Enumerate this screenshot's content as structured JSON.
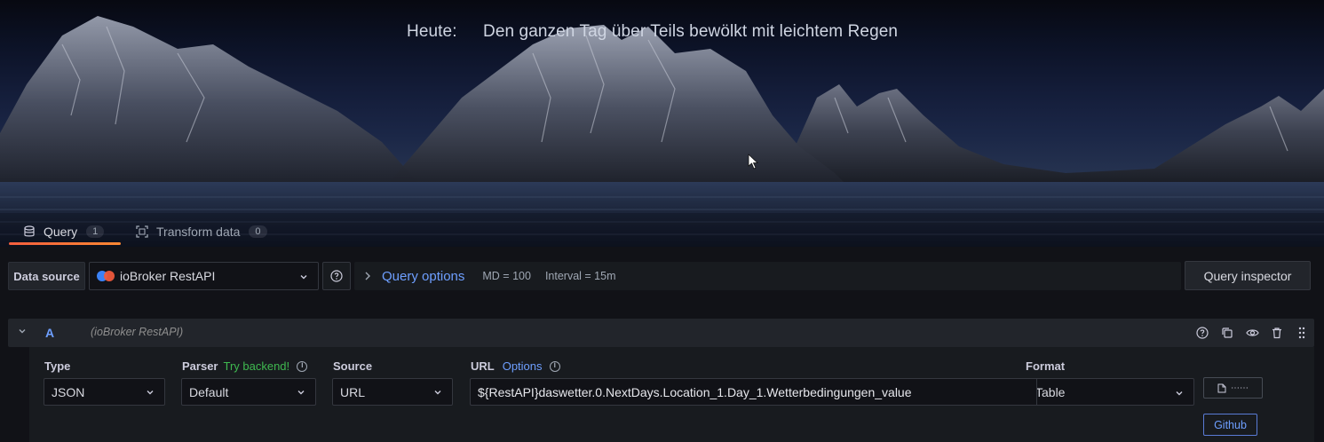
{
  "hero": {
    "label": "Heute:",
    "value": "Den ganzen Tag über Teils bewölkt mit leichtem Regen"
  },
  "tabs": [
    {
      "label": "Query",
      "count": "1",
      "icon": "database-icon",
      "active": true
    },
    {
      "label": "Transform data",
      "count": "0",
      "icon": "transform-icon",
      "active": false
    }
  ],
  "datasource": {
    "label": "Data source",
    "selected": "ioBroker RestAPI"
  },
  "query_options": {
    "title": "Query options",
    "md": "MD = 100",
    "interval": "Interval = 15m"
  },
  "query_inspector": "Query inspector",
  "query_row": {
    "name": "A",
    "datasource": "(ioBroker RestAPI)",
    "actions": [
      "help-icon",
      "copy-icon",
      "eye-icon",
      "trash-icon",
      "drag-handle-icon"
    ]
  },
  "fields": {
    "type": {
      "label": "Type",
      "value": "JSON"
    },
    "parser": {
      "label": "Parser",
      "hint": "Try backend!",
      "value": "Default"
    },
    "source": {
      "label": "Source",
      "value": "URL"
    },
    "url": {
      "label": "URL",
      "options_link": "Options",
      "value": "${RestAPI}daswetter.0.NextDays.Location_1.Day_1.Wetterbedingungen_value"
    },
    "format": {
      "label": "Format",
      "value": "Table"
    }
  },
  "buttons": {
    "small": "⋯⋯",
    "github": "Github"
  },
  "colors": {
    "accent_blue": "#6e9fff",
    "tab_underline": "#f55f3e",
    "hint_green": "#3fb950"
  }
}
